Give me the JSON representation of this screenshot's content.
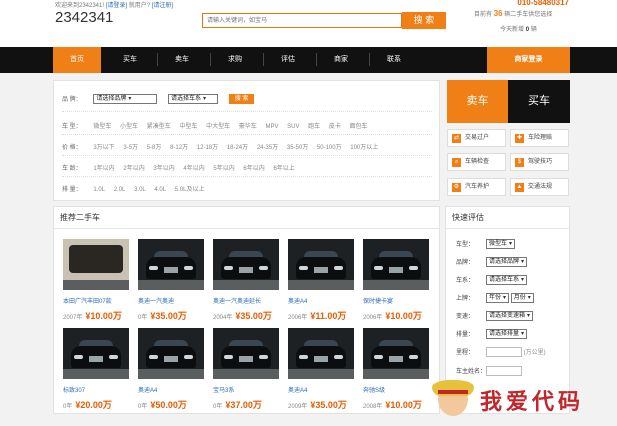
{
  "topbar": {
    "welcome": "欢迎来到2342341!",
    "register": "[请登录]",
    "fav_prefix": "就用户?",
    "fav_link": "[请注册]",
    "phone": "010-58480317"
  },
  "header": {
    "logo": "2342341",
    "search_placeholder": "请输入关键词，如宝马",
    "search_button": "搜 索",
    "stat1_prefix": "目前有",
    "stat1_count": "36",
    "stat1_suffix": "辆二手车供您选择",
    "stat2_prefix": "今天新增",
    "stat2_count": "0",
    "stat2_suffix": "辆"
  },
  "nav": {
    "items": [
      "首页",
      "买车",
      "卖车",
      "求购",
      "评估",
      "商家",
      "联系"
    ],
    "dealer_login": "商家登录"
  },
  "filter": {
    "brand_label": "品 牌：",
    "brand_select": "请选择品牌",
    "series_select": "请选择车系",
    "search_btn": "搜 索",
    "type_label": "车 型：",
    "types": [
      "微型车",
      "小型车",
      "紧凑型车",
      "中型车",
      "中大型车",
      "豪华车",
      "MPV",
      "SUV",
      "跑车",
      "皮卡",
      "面包车"
    ],
    "price_label": "价 格：",
    "prices": [
      "3万以下",
      "3-5万",
      "5-8万",
      "8-12万",
      "12-18万",
      "18-24万",
      "24-35万",
      "35-50万",
      "50-100万",
      "100万以上"
    ],
    "age_label": "车 龄：",
    "ages": [
      "1年以内",
      "2年以内",
      "3年以内",
      "4年以内",
      "5年以内",
      "6年以内",
      "6年以上"
    ],
    "disp_label": "排 量：",
    "disps": [
      "1.0L",
      "2.0L",
      "3.0L",
      "4.0L",
      "5.0L及以上"
    ]
  },
  "side": {
    "sell": "卖车",
    "buy": "买车",
    "services": [
      "交易过户",
      "车险理赔",
      "车辆检查",
      "驾驶技巧",
      "汽车养护",
      "交通法规"
    ]
  },
  "recommend": {
    "title": "推荐二手车",
    "cars": [
      {
        "name": "本田广汽丰田07款",
        "year": "2007年",
        "price": "¥10.00万",
        "interior": true
      },
      {
        "name": "奥迪一汽奥迪",
        "year": "0年",
        "price": "¥35.00万",
        "interior": false
      },
      {
        "name": "奥迪一汽奥迪延长",
        "year": "2004年",
        "price": "¥35.00万",
        "interior": false
      },
      {
        "name": "奥迪A4",
        "year": "2006年",
        "price": "¥11.00万",
        "interior": false
      },
      {
        "name": "保时捷卡宴",
        "year": "2006年",
        "price": "¥10.00万",
        "interior": false
      },
      {
        "name": "标致307",
        "year": "0年",
        "price": "¥20.00万",
        "interior": false
      },
      {
        "name": "奥迪A4",
        "year": "0年",
        "price": "¥50.00万",
        "interior": false
      },
      {
        "name": "宝马3系",
        "year": "0年",
        "price": "¥37.00万",
        "interior": false
      },
      {
        "name": "奥迪A4",
        "year": "2009年",
        "price": "¥35.00万",
        "interior": false
      },
      {
        "name": "奔驰S级",
        "year": "2008年",
        "price": "¥10.00万",
        "interior": false
      }
    ]
  },
  "valuation": {
    "title": "快速评估",
    "type_label": "车型：",
    "type_select": "微型车",
    "brand_label": "品牌：",
    "brand_select": "请选择品牌",
    "series_label": "车系：",
    "series_select": "请选择车系",
    "date_label": "上牌：",
    "year_select": "年份",
    "month_select": "月份",
    "gear_label": "变速：",
    "gear_select": "请选择变速箱",
    "disp_label": "排量：",
    "disp_select": "请选择排量",
    "mileage_label": "里程：",
    "mileage_unit": "(万公里)",
    "owner_label": "车主姓名："
  },
  "watermark": {
    "text": "我爱代码"
  }
}
